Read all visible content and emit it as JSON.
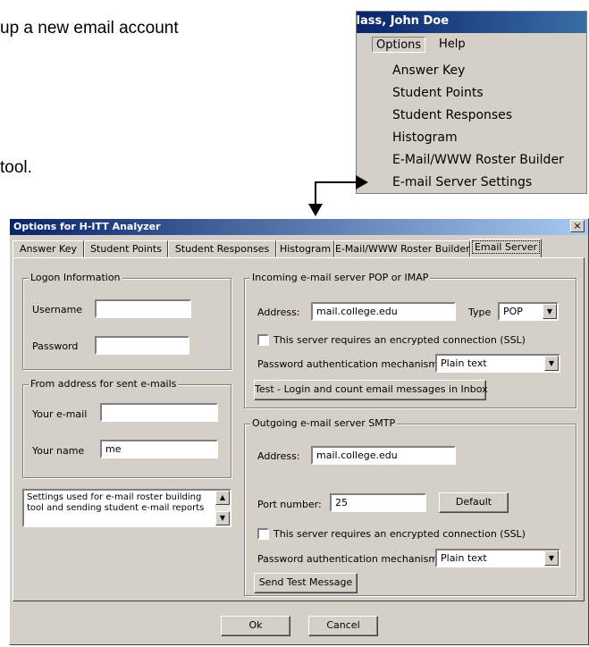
{
  "doc": {
    "line1": "up a new email account",
    "line2": "tool."
  },
  "menu": {
    "window_title": "Class, John Doe",
    "bar": {
      "options": "Options",
      "help": "Help"
    },
    "items": [
      "Answer Key",
      "Student Points",
      "Student Responses",
      "Histogram",
      "E-Mail/WWW Roster Builder",
      "E-mail Server Settings"
    ]
  },
  "dialog": {
    "title": "Options for H-ITT Analyzer",
    "close": "×",
    "tabs": [
      "Answer Key",
      "Student Points",
      "Student Responses",
      "Histogram",
      "E-Mail/WWW Roster Builder",
      "Email Server"
    ],
    "logon": {
      "group": "Logon Information",
      "username_label": "Username",
      "username_value": "",
      "password_label": "Password",
      "password_value": ""
    },
    "from": {
      "group": "From address for sent e-mails",
      "email_label": "Your e-mail",
      "email_value": "",
      "name_label": "Your name",
      "name_value": "me"
    },
    "info_text": "Settings used for e-mail roster building tool and sending student e-mail reports",
    "incoming": {
      "group": "Incoming e-mail server POP or IMAP",
      "address_label": "Address:",
      "address_value": "mail.college.edu",
      "type_label": "Type",
      "type_value": "POP",
      "ssl_label": "This server requires an encrypted connection (SSL)",
      "auth_label": "Password authentication mechanism",
      "auth_value": "Plain text",
      "test_button": "Test - Login and count email messages in Inbox"
    },
    "outgoing": {
      "group": "Outgoing e-mail server SMTP",
      "address_label": "Address:",
      "address_value": "mail.college.edu",
      "port_label": "Port number:",
      "port_value": "25",
      "default_button": "Default",
      "ssl_label": "This server requires an encrypted connection (SSL)",
      "auth_label": "Password authentication mechanism",
      "auth_value": "Plain text",
      "send_test_button": "Send Test Message"
    },
    "ok_button": "Ok",
    "cancel_button": "Cancel"
  }
}
